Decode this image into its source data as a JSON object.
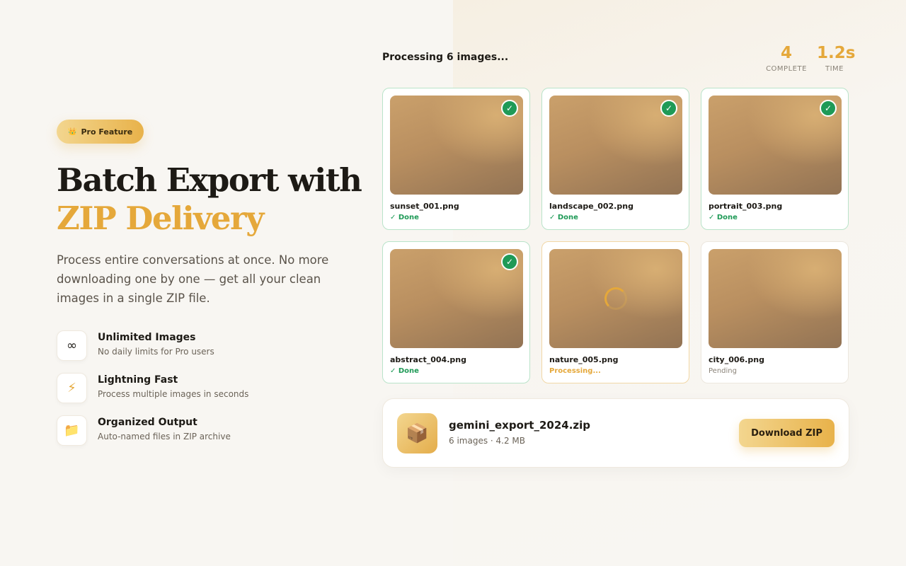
{
  "hero": {
    "badge_icon": "👑",
    "badge_label": "Pro Feature",
    "title_line1": "Batch Export with",
    "title_line2": "ZIP Delivery",
    "description": "Process entire conversations at once. No more downloading one by one — get all your clean images in a single ZIP file."
  },
  "features": [
    {
      "icon": "∞",
      "icon_name": "infinity-icon",
      "title": "Unlimited Images",
      "subtitle": "No daily limits for Pro users"
    },
    {
      "icon": "⚡",
      "icon_name": "lightning-icon",
      "title": "Lightning Fast",
      "subtitle": "Process multiple images in seconds"
    },
    {
      "icon": "📁",
      "icon_name": "folder-icon",
      "title": "Organized Output",
      "subtitle": "Auto-named files in ZIP archive"
    }
  ],
  "processing": {
    "title": "Processing 6 images...",
    "stats": [
      {
        "value": "4",
        "label": "COMPLETE"
      },
      {
        "value": "1.2s",
        "label": "TIME"
      }
    ]
  },
  "images": [
    {
      "filename": "sunset_001.png",
      "status": "done",
      "status_label": "✓ Done"
    },
    {
      "filename": "landscape_002.png",
      "status": "done",
      "status_label": "✓ Done"
    },
    {
      "filename": "portrait_003.png",
      "status": "done",
      "status_label": "✓ Done"
    },
    {
      "filename": "abstract_004.png",
      "status": "done",
      "status_label": "✓ Done"
    },
    {
      "filename": "nature_005.png",
      "status": "processing",
      "status_label": "Processing..."
    },
    {
      "filename": "city_006.png",
      "status": "pending",
      "status_label": "Pending"
    }
  ],
  "check_glyph": "✓",
  "zip": {
    "icon": "📦",
    "filename": "gemini_export_2024.zip",
    "meta": "6 images · 4.2 MB",
    "download_label": "Download ZIP"
  },
  "colors": {
    "accent": "#e5a83a",
    "success": "#1f9a57",
    "background": "#f8f6f2"
  }
}
